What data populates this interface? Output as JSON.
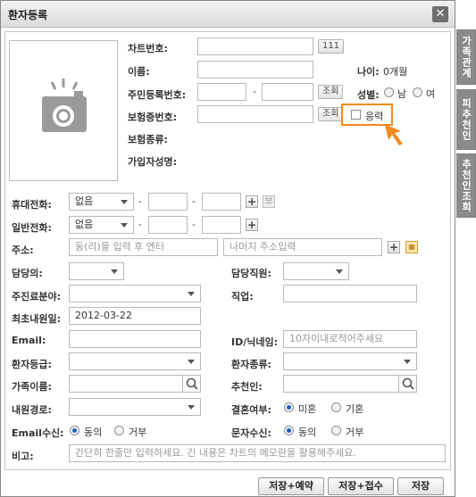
{
  "dialog": {
    "title": "환자등록",
    "close": "✕"
  },
  "side_tabs": [
    "가족관계",
    "피추천인",
    "추천인조회"
  ],
  "fields": {
    "chart_no": {
      "label": "차트번호:",
      "button": "111"
    },
    "name": {
      "label": "이름:"
    },
    "age": {
      "label": "나이:",
      "value": "0개월"
    },
    "resident_no": {
      "label": "주민등록번호:",
      "sep": "-",
      "button": "조회"
    },
    "gender": {
      "label": "성별:",
      "options": [
        "남",
        "여"
      ]
    },
    "insurance_no": {
      "label": "보험증번호:",
      "button": "조회"
    },
    "eungeup": {
      "label": "응력"
    },
    "insurance_type": {
      "label": "보험종류:"
    },
    "subscriber": {
      "label": "가입자성명:"
    },
    "mobile": {
      "label": "휴대전화:",
      "select": "없음",
      "sep": "-",
      "bo": "보"
    },
    "phone": {
      "label": "일반전화:",
      "select": "없음",
      "sep": "-"
    },
    "address": {
      "label": "주소:",
      "placeholder1": "동(리)을 입력 후 엔터",
      "placeholder2": "나머지 주소입력"
    },
    "doctor": {
      "label": "담당의:"
    },
    "staff": {
      "label": "담당직원:"
    },
    "treatment": {
      "label": "주진료분야:"
    },
    "job": {
      "label": "직업:"
    },
    "first_visit": {
      "label": "최초내원일:",
      "value": "2012-03-22"
    },
    "email": {
      "label": "Email:"
    },
    "nickname": {
      "label": "ID/닉네임:",
      "placeholder": "10자이내로적어주세요"
    },
    "patient_grade": {
      "label": "환자등급:"
    },
    "patient_type": {
      "label": "환자종류:"
    },
    "family_name": {
      "label": "가족이름:"
    },
    "referrer": {
      "label": "추천인:"
    },
    "visit_route": {
      "label": "내원경로:"
    },
    "marital": {
      "label": "결혼여부:",
      "options": [
        "미혼",
        "기혼"
      ]
    },
    "email_receive": {
      "label": "Email수신:",
      "options": [
        "동의",
        "거부"
      ]
    },
    "sms_receive": {
      "label": "문자수신:",
      "options": [
        "동의",
        "거부"
      ]
    },
    "memo": {
      "label": "비고:",
      "placeholder": "간단히 한줄만 입력하세요. 긴 내용은 차트의 메모란을 활용해주세요."
    }
  },
  "buttons": {
    "save_reserve": "저장+예약",
    "save_receipt": "저장+접수",
    "save": "저장"
  },
  "colors": {
    "accent": "#f28a1e",
    "radio_on": "#1f5fbf",
    "tab_active": "#8a8a8a"
  }
}
